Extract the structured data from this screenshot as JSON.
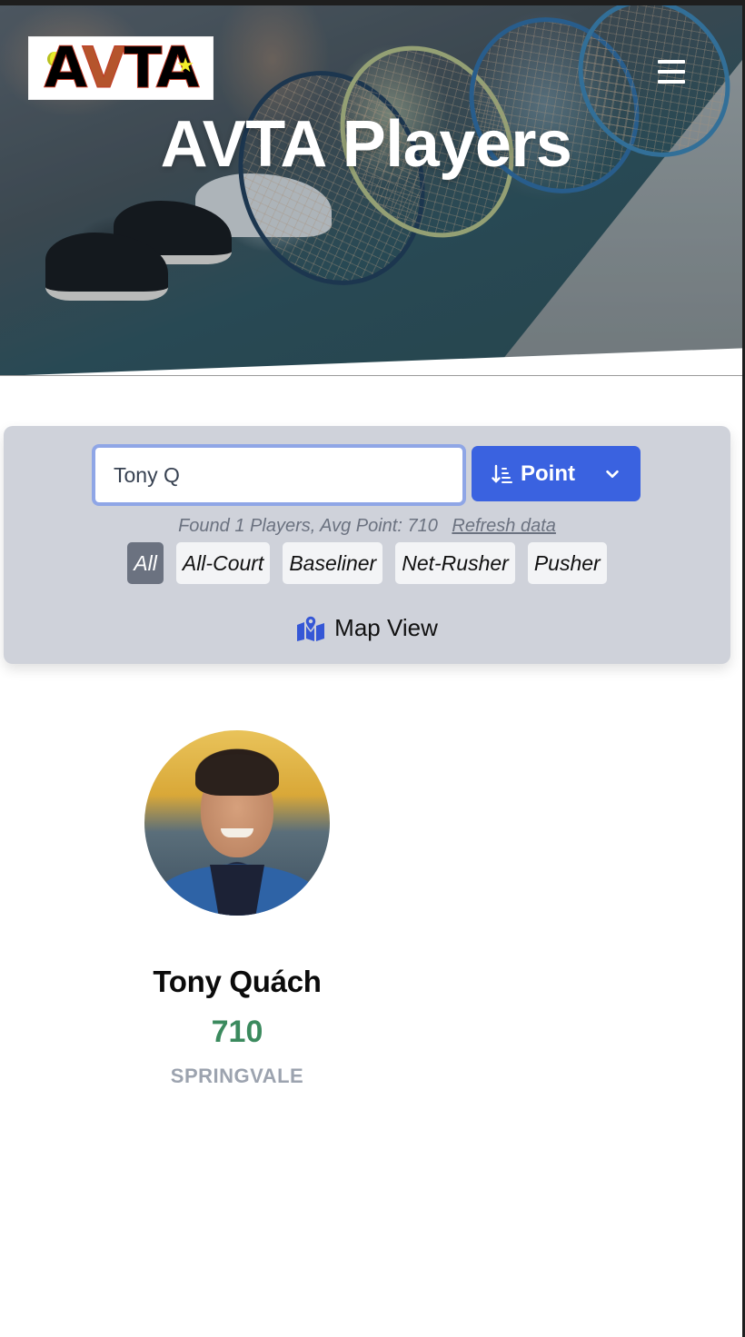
{
  "header": {
    "logo_text": "AVTA",
    "title": "AVTA Players",
    "menu_icon": "hamburger-menu-icon"
  },
  "filters": {
    "search": {
      "value": "Tony Q",
      "placeholder": ""
    },
    "sort": {
      "label": "Point",
      "icon": "sort-descending-icon",
      "chevron": "chevron-down-icon"
    },
    "summary": "Found 1 Players, Avg Point: 710",
    "refresh_label": "Refresh data",
    "play_styles": [
      {
        "label": "All",
        "active": true
      },
      {
        "label": "All-Court",
        "active": false
      },
      {
        "label": "Baseliner",
        "active": false
      },
      {
        "label": "Net-Rusher",
        "active": false
      },
      {
        "label": "Pusher",
        "active": false
      }
    ],
    "map_view_label": "Map View",
    "map_view_icon": "map-location-icon"
  },
  "players": [
    {
      "name": "Tony Quách",
      "points": "710",
      "club": "SPRINGVALE"
    }
  ],
  "colors": {
    "accent": "#3a62e0",
    "points_green": "#3b8a5e",
    "panel_bg": "#cfd2da",
    "chip_active": "#6b7280",
    "club_gray": "#9ca3af"
  }
}
